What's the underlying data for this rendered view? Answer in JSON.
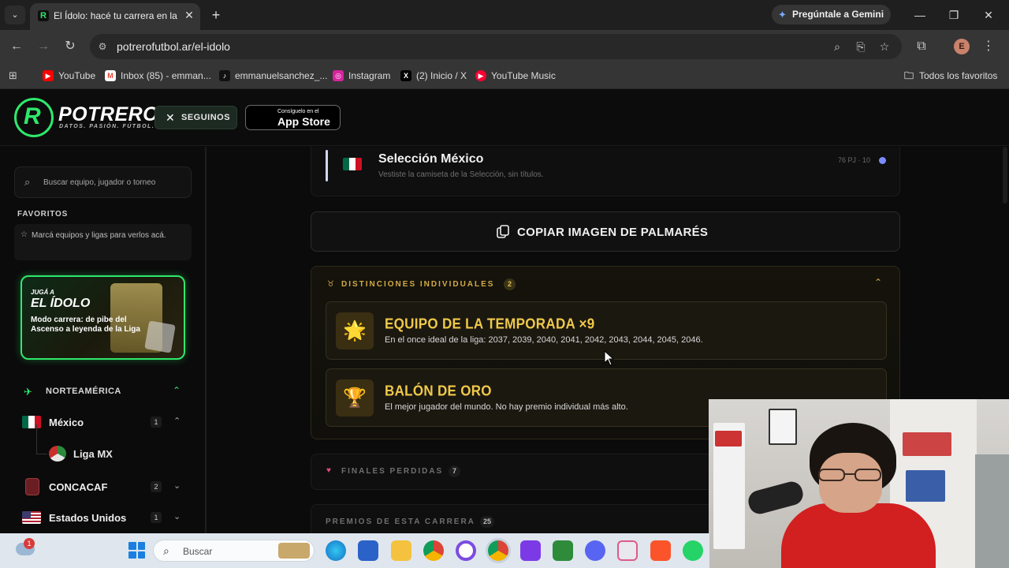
{
  "browser": {
    "tab_title": "El Ídolo: hacé tu carrera en la Liga",
    "tab_favicon": "R",
    "gemini_label": "Pregúntale a Gemini",
    "url": "potrerofutbol.ar/el-idolo",
    "profile_initial": "E",
    "bookmarks": [
      {
        "label": "YouTube",
        "icon": "youtube-icon",
        "color": "#ff0000"
      },
      {
        "label": "Inbox (85) - emman...",
        "icon": "gmail-icon",
        "color": "#ea4335"
      },
      {
        "label": "emmanuelsanchez_...",
        "icon": "tiktok-icon",
        "color": "#000000"
      },
      {
        "label": "Instagram",
        "icon": "instagram-icon",
        "color": "#d6249f"
      },
      {
        "label": "(2) Inicio / X",
        "icon": "x-icon",
        "color": "#000000"
      },
      {
        "label": "YouTube Music",
        "icon": "youtube-music-icon",
        "color": "#ff0033"
      }
    ],
    "all_bookmarks_label": "Todos los favoritos"
  },
  "site": {
    "logo_text": "POTRERO",
    "logo_letter": "R",
    "logo_tagline": "DATOS. PASIÓN. FÚTBOL.",
    "follow_label": "SEGUINOS",
    "appstore_small": "Consíguelo en el",
    "appstore_big": "App Store"
  },
  "sidebar": {
    "search_placeholder": "Buscar equipo, jugador o torneo",
    "favorites_title": "FAVORITOS",
    "favorites_empty": "Marcá equipos y ligas para verlos acá.",
    "promo": {
      "small": "JUGÁ A",
      "big": "EL ÍDOLO",
      "desc": "Modo carrera: de pibe del Ascenso a leyenda de la Liga"
    },
    "region_label": "NORTEAMÉRICA",
    "countries": [
      {
        "label": "México",
        "count": "1"
      },
      {
        "label": "CONCACAF",
        "count": "2"
      },
      {
        "label": "Estados Unidos",
        "count": "1"
      }
    ],
    "league_label": "Liga MX"
  },
  "main": {
    "selection": {
      "title": "Selección México",
      "subtitle": "Vestiste la camiseta de la Selección, sin títulos.",
      "stats": "76 PJ · 10"
    },
    "copy_button": "COPIAR IMAGEN DE PALMARÉS",
    "distinctions": {
      "title": "DISTINCIONES INDIVIDUALES",
      "count": "2",
      "awards": [
        {
          "title": "EQUIPO DE LA TEMPORADA ×9",
          "desc": "En el once ideal de la liga: 2037, 2039, 2040, 2041, 2042, 2043, 2044, 2045, 2046.",
          "icon": "star-burst-icon",
          "glyph": "🌟"
        },
        {
          "title": "BALÓN DE ORO",
          "desc": "El mejor jugador del mundo. No hay premio individual más alto.",
          "icon": "trophy-icon",
          "glyph": "🏆"
        }
      ]
    },
    "finals": {
      "title": "FINALES PERDIDAS",
      "count": "7"
    },
    "prizes": {
      "title": "PREMIOS DE ESTA CARRERA",
      "count": "25"
    }
  },
  "taskbar": {
    "search_placeholder": "Buscar",
    "weather_badge": "1"
  },
  "colors": {
    "brand_green": "#2ee86b",
    "gold": "#f0c94a",
    "pink": "#e14d77"
  }
}
